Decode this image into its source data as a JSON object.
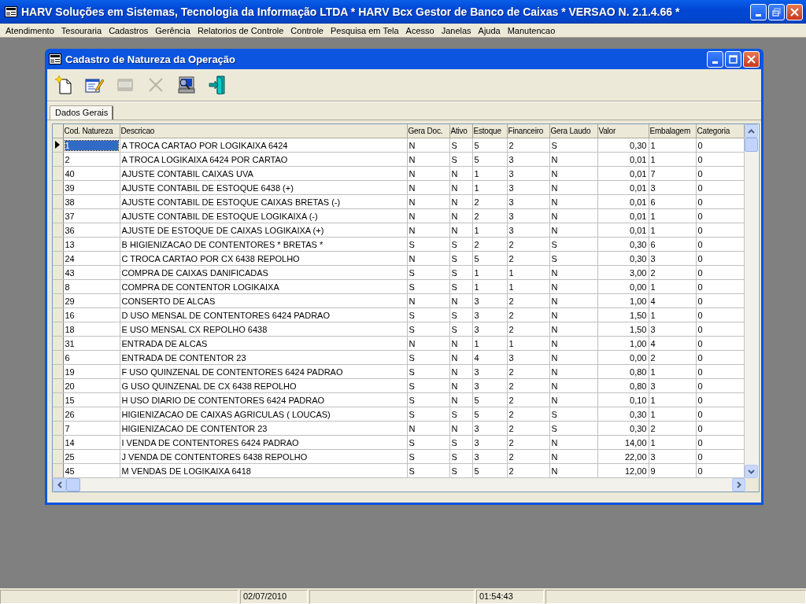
{
  "window": {
    "title": "HARV Soluções em Sistemas, Tecnologia da Informação LTDA * HARV Bcx Gestor de Banco de Caixas * VERSAO N.  2.1.4.66 *"
  },
  "menu": [
    "Atendimento",
    "Tesouraria",
    "Cadastros",
    "Gerência",
    "Relatorios de Controle",
    "Controle",
    "Pesquisa em Tela",
    "Acesso",
    "Janelas",
    "Ajuda",
    "Manutencao"
  ],
  "dialog": {
    "title": "Cadastro de Natureza da Operação",
    "toolbar": [
      {
        "kind": "new",
        "disabled": false
      },
      {
        "kind": "edit",
        "disabled": false
      },
      {
        "kind": "keyboard",
        "disabled": true
      },
      {
        "kind": "delete",
        "disabled": true
      },
      {
        "kind": "search",
        "disabled": false
      },
      {
        "kind": "exit",
        "disabled": false
      }
    ],
    "tabs": [
      {
        "label": "Dados Gerais",
        "selected": true
      }
    ],
    "table": {
      "columns": [
        {
          "label": "Cod. Natureza",
          "kind": "text"
        },
        {
          "label": "Descricao",
          "kind": "text"
        },
        {
          "label": "Gera Doc.",
          "kind": "text"
        },
        {
          "label": "Ativo",
          "kind": "text"
        },
        {
          "label": "Estoque",
          "kind": "text"
        },
        {
          "label": "Financeiro",
          "kind": "text"
        },
        {
          "label": "Gera Laudo",
          "kind": "text"
        },
        {
          "label": "Valor",
          "kind": "number"
        },
        {
          "label": "Embalagem",
          "kind": "text"
        },
        {
          "label": "Categoria",
          "kind": "text"
        }
      ],
      "rows": [
        {
          "selected": true,
          "cells": [
            "1",
            "A TROCA CARTAO POR LOGIKAIXA 6424",
            "N",
            "S",
            "5",
            "2",
            "S",
            "0,30",
            "1",
            "0"
          ]
        },
        {
          "selected": false,
          "cells": [
            "2",
            "A TROCA LOGIKAIXA 6424  POR CARTAO",
            "N",
            "S",
            "5",
            "3",
            "N",
            "0,01",
            "1",
            "0"
          ]
        },
        {
          "selected": false,
          "cells": [
            "40",
            "AJUSTE CONTABIL CAIXAS UVA",
            "N",
            "N",
            "1",
            "3",
            "N",
            "0,01",
            "7",
            "0"
          ]
        },
        {
          "selected": false,
          "cells": [
            "39",
            "AJUSTE CONTABIL DE ESTOQUE 6438 (+)",
            "N",
            "N",
            "1",
            "3",
            "N",
            "0,01",
            "3",
            "0"
          ]
        },
        {
          "selected": false,
          "cells": [
            "38",
            "AJUSTE CONTABIL DE ESTOQUE CAIXAS BRETAS (-)",
            "N",
            "N",
            "2",
            "3",
            "N",
            "0,01",
            "6",
            "0"
          ]
        },
        {
          "selected": false,
          "cells": [
            "37",
            "AJUSTE CONTABIL DE ESTOQUE LOGIKAIXA (-)",
            "N",
            "N",
            "2",
            "3",
            "N",
            "0,01",
            "1",
            "0"
          ]
        },
        {
          "selected": false,
          "cells": [
            "36",
            "AJUSTE DE ESTOQUE DE CAIXAS LOGIKAIXA  (+)",
            "N",
            "N",
            "1",
            "3",
            "N",
            "0,01",
            "1",
            "0"
          ]
        },
        {
          "selected": false,
          "cells": [
            "13",
            "B  HIGIENIZACAO DE CONTENTORES * BRETAS *",
            "S",
            "S",
            "2",
            "2",
            "S",
            "0,30",
            "6",
            "0"
          ]
        },
        {
          "selected": false,
          "cells": [
            "24",
            "C TROCA CARTAO POR CX 6438 REPOLHO",
            "N",
            "S",
            "5",
            "2",
            "S",
            "0,30",
            "3",
            "0"
          ]
        },
        {
          "selected": false,
          "cells": [
            "43",
            "COMPRA DE CAIXAS DANIFICADAS",
            "S",
            "S",
            "1",
            "1",
            "N",
            "3,00",
            "2",
            "0"
          ]
        },
        {
          "selected": false,
          "cells": [
            "8",
            "COMPRA DE CONTENTOR LOGIKAIXA",
            "S",
            "S",
            "1",
            "1",
            "N",
            "0,00",
            "1",
            "0"
          ]
        },
        {
          "selected": false,
          "cells": [
            "29",
            "CONSERTO DE ALCAS",
            "N",
            "N",
            "3",
            "2",
            "N",
            "1,00",
            "4",
            "0"
          ]
        },
        {
          "selected": false,
          "cells": [
            "16",
            "D  USO MENSAL DE CONTENTORES 6424 PADRAO",
            "S",
            "S",
            "3",
            "2",
            "N",
            "1,50",
            "1",
            "0"
          ]
        },
        {
          "selected": false,
          "cells": [
            "18",
            "E  USO MENSAL CX REPOLHO 6438",
            "S",
            "S",
            "3",
            "2",
            "N",
            "1,50",
            "3",
            "0"
          ]
        },
        {
          "selected": false,
          "cells": [
            "31",
            "ENTRADA DE ALCAS",
            "N",
            "N",
            "1",
            "1",
            "N",
            "1,00",
            "4",
            "0"
          ]
        },
        {
          "selected": false,
          "cells": [
            "6",
            "ENTRADA DE CONTENTOR 23",
            "S",
            "N",
            "4",
            "3",
            "N",
            "0,00",
            "2",
            "0"
          ]
        },
        {
          "selected": false,
          "cells": [
            "19",
            "F  USO  QUINZENAL  DE CONTENTORES 6424 PADRAO",
            "S",
            "N",
            "3",
            "2",
            "N",
            "0,80",
            "1",
            "0"
          ]
        },
        {
          "selected": false,
          "cells": [
            "20",
            "G  USO  QUINZENAL  DE CX  6438 REPOLHO",
            "S",
            "N",
            "3",
            "2",
            "N",
            "0,80",
            "3",
            "0"
          ]
        },
        {
          "selected": false,
          "cells": [
            "15",
            "H  USO DIARIO DE CONTENTORES 6424 PADRAO",
            "S",
            "N",
            "5",
            "2",
            "N",
            "0,10",
            "1",
            "0"
          ]
        },
        {
          "selected": false,
          "cells": [
            "26",
            "HIGIENIZACAO  DE CAIXAS AGRICULAS ( LOUCAS)",
            "S",
            "S",
            "5",
            "2",
            "S",
            "0,30",
            "1",
            "0"
          ]
        },
        {
          "selected": false,
          "cells": [
            "7",
            "HIGIENIZACAO  DE CONTENTOR 23",
            "N",
            "N",
            "3",
            "2",
            "S",
            "0,30",
            "2",
            "0"
          ]
        },
        {
          "selected": false,
          "cells": [
            "14",
            "I VENDA DE CONTENTORES 6424 PADRAO",
            "S",
            "S",
            "3",
            "2",
            "N",
            "14,00",
            "1",
            "0"
          ]
        },
        {
          "selected": false,
          "cells": [
            "25",
            "J VENDA DE CONTENTORES 6438 REPOLHO",
            "S",
            "S",
            "3",
            "2",
            "N",
            "22,00",
            "3",
            "0"
          ]
        },
        {
          "selected": false,
          "cells": [
            "45",
            "M VENDAS DE LOGIKAIXA 6418",
            "S",
            "S",
            "5",
            "2",
            "N",
            "12,00",
            "9",
            "0"
          ]
        }
      ]
    }
  },
  "status_bar": {
    "date": "02/07/2010",
    "time": "01:54:43"
  }
}
